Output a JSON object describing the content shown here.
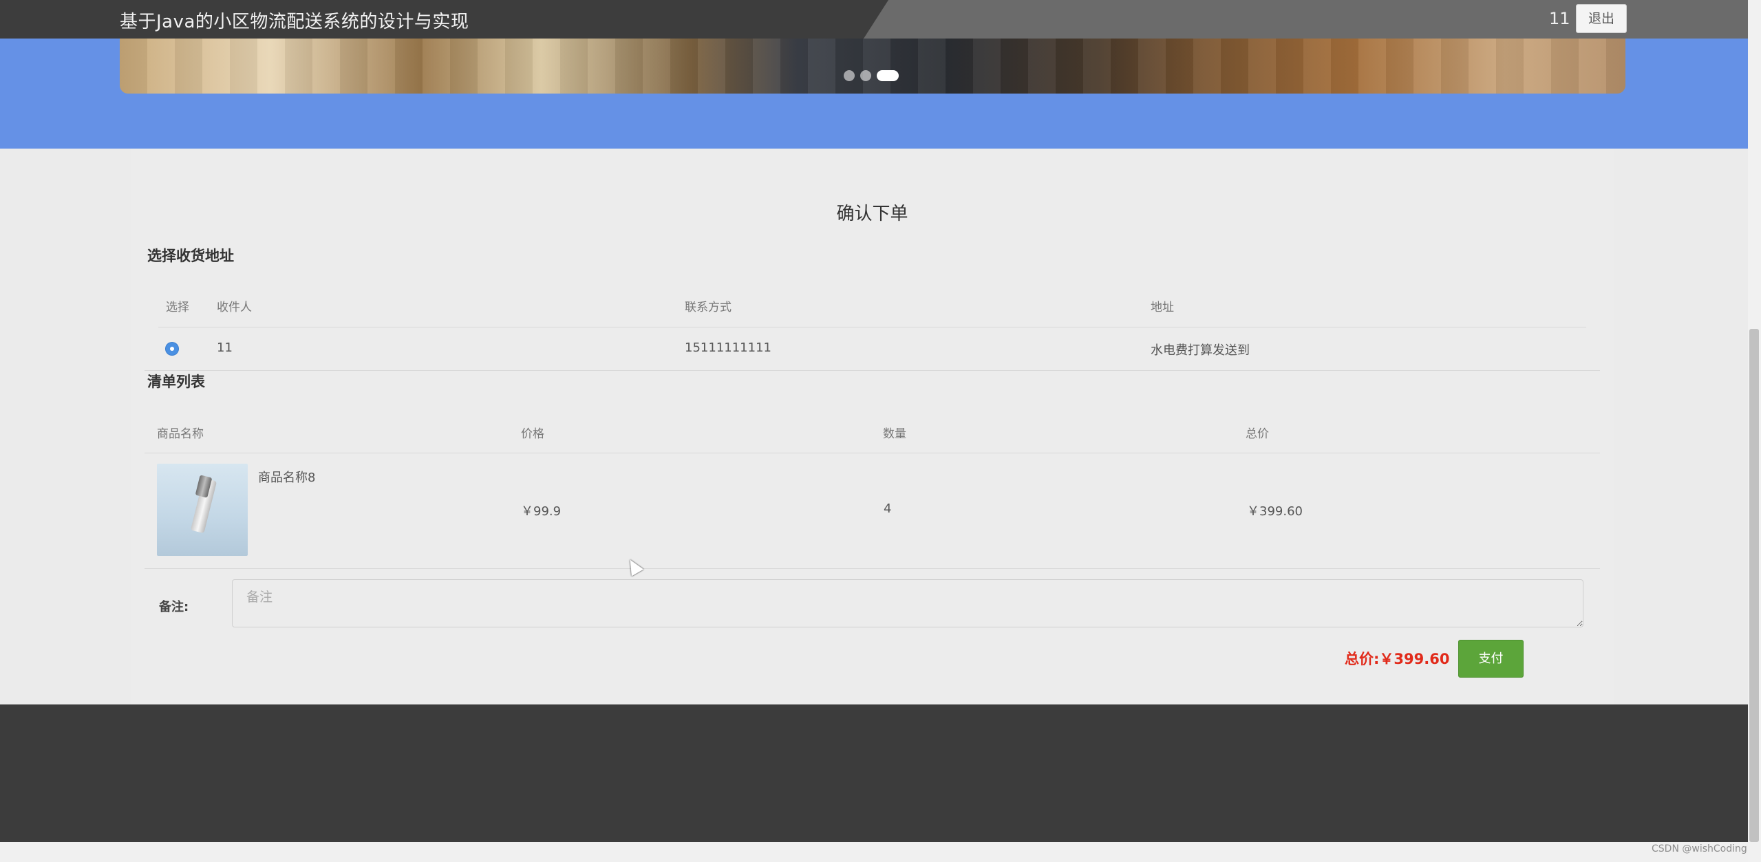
{
  "header": {
    "app_title": "基于Java的小区物流配送系统的设计与实现",
    "user_name": "11",
    "logout_label": "退出"
  },
  "carousel": {
    "slide_count": 3,
    "active_slide": 3
  },
  "page": {
    "heading": "确认下单",
    "address_section_title": "选择收货地址",
    "address_table": {
      "headers": [
        "选择",
        "收件人",
        "联系方式",
        "地址"
      ],
      "rows": [
        {
          "selected": true,
          "recipient": "11",
          "phone": "15111111111",
          "address": "水电费打算发送到"
        }
      ]
    },
    "order_section_title": "清单列表",
    "order_table": {
      "headers": [
        "商品名称",
        "价格",
        "数量",
        "总价"
      ],
      "rows": [
        {
          "name": "商品名称8",
          "price": "￥99.9",
          "quantity": "4",
          "subtotal": "￥399.60"
        }
      ]
    },
    "remark_label": "备注:",
    "remark_placeholder": "备注",
    "total_label": "总价:￥399.60",
    "pay_label": "支付"
  },
  "watermark": "CSDN @wishCoding"
}
